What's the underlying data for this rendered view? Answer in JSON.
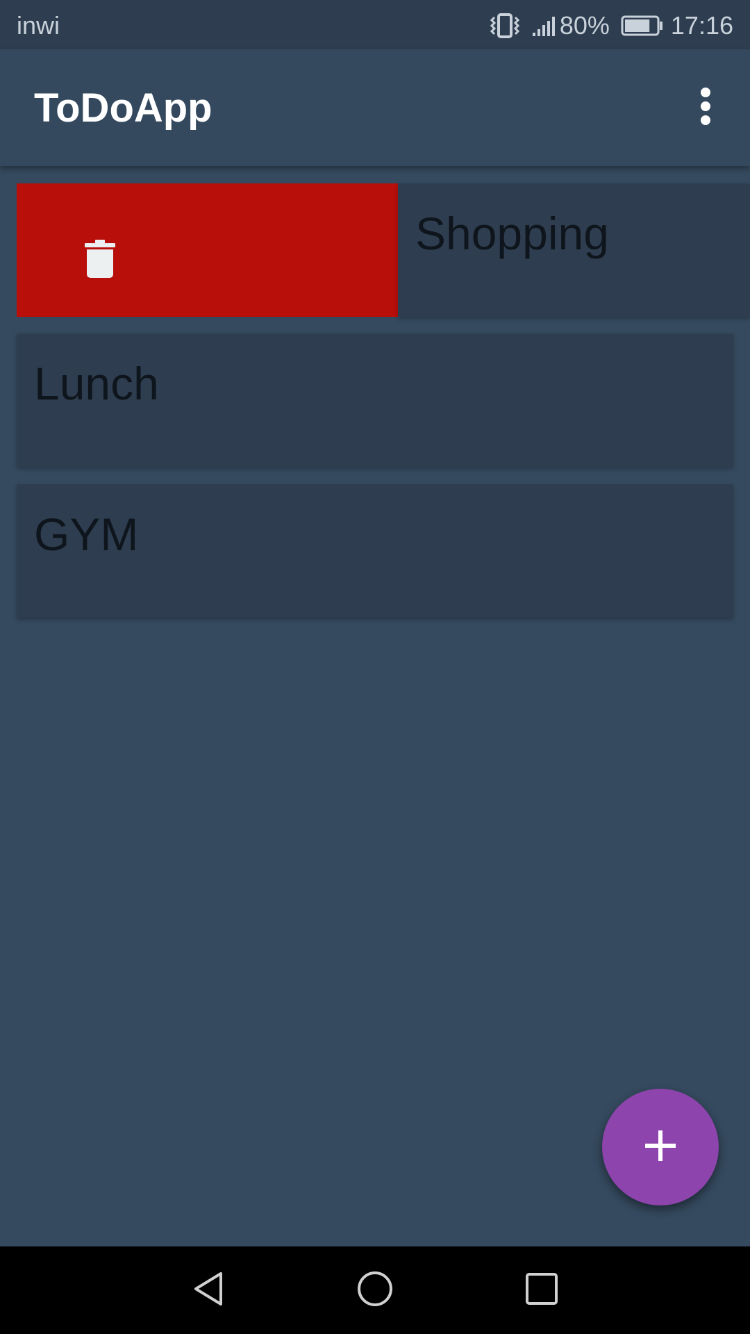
{
  "status_bar": {
    "carrier": "inwi",
    "battery_percent": "80%",
    "time": "17:16",
    "icons": [
      "vibrate-icon",
      "signal-icon",
      "battery-icon"
    ],
    "battery_level": 0.8
  },
  "app_bar": {
    "title": "ToDoApp",
    "menu_icon": "more-vert-icon"
  },
  "todos": [
    {
      "title": "Shopping",
      "swiped": true,
      "action_icon": "trash-icon"
    },
    {
      "title": "Lunch",
      "swiped": false
    },
    {
      "title": "GYM",
      "swiped": false
    }
  ],
  "fab": {
    "icon": "plus-icon"
  },
  "nav_bar": {
    "icons": [
      "back-icon",
      "home-icon",
      "recents-icon"
    ]
  },
  "colors": {
    "background": "#354a5f",
    "app_bar": "#34495e",
    "status_bar": "#2e3e50",
    "card": "#2e3e50",
    "delete": "#b80f0a",
    "fab": "#8e44ad",
    "nav_bar": "#000000",
    "card_text": "#0f151c"
  }
}
